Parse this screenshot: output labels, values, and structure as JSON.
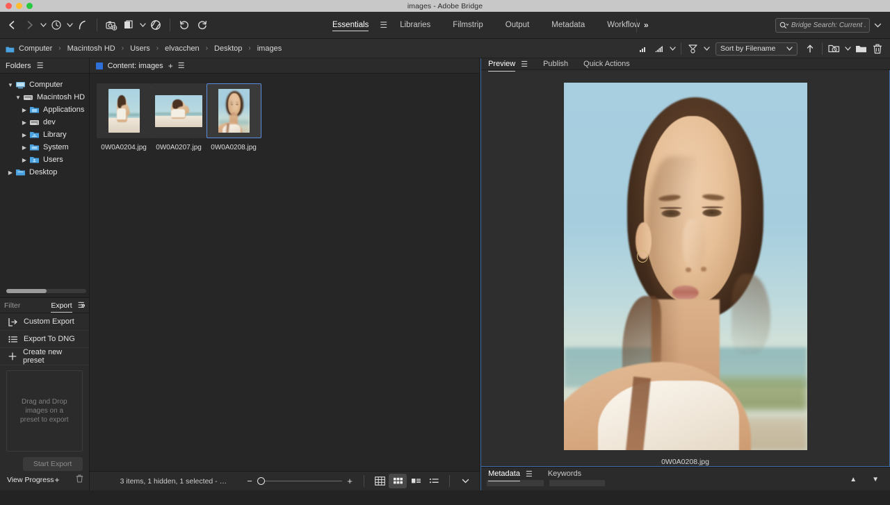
{
  "window": {
    "title": "images - Adobe Bridge"
  },
  "toolbar": {
    "icons": [
      "back-arrow",
      "forward-arrow",
      "chevron-down",
      "recent-folders-clock",
      "chevron-down",
      "boomerang-reveal",
      "get-photos-from-camera",
      "refine-stack",
      "chevron-down",
      "open-in-camera-raw",
      "rotate-counter-clockwise",
      "rotate-clockwise"
    ],
    "workspaces": [
      {
        "label": "Essentials",
        "active": true
      },
      {
        "label": "Libraries",
        "active": false
      },
      {
        "label": "Filmstrip",
        "active": false
      },
      {
        "label": "Output",
        "active": false
      },
      {
        "label": "Metadata",
        "active": false
      },
      {
        "label": "Workflow",
        "active": false
      }
    ],
    "more_label": "»",
    "search": {
      "value": "Bridge Search: Current .",
      "icon": "search-icon"
    }
  },
  "pathbar": {
    "crumbs": [
      "Computer",
      "Macintosh HD",
      "Users",
      "elvacchen",
      "Desktop",
      "images"
    ],
    "separator": "›",
    "sort": {
      "label": "Sort by Filename"
    },
    "icons": [
      "filter-rating-low",
      "filter-rating-high",
      "filter-items-funnel",
      "sort-ascending-arrow",
      "new-folder-recent",
      "new-folder",
      "delete-trash"
    ]
  },
  "folders_panel": {
    "title": "Folders",
    "menu_icon": "panel-menu-icon",
    "tree": [
      {
        "label": "Computer",
        "depth": 0,
        "expanded": true,
        "icon": "computer-icon"
      },
      {
        "label": "Macintosh HD",
        "depth": 1,
        "expanded": true,
        "icon": "hard-drive-icon"
      },
      {
        "label": "Applications",
        "depth": 2,
        "expanded": false,
        "icon": "folder-applications-icon"
      },
      {
        "label": "dev",
        "depth": 2,
        "expanded": false,
        "icon": "folder-dev-icon"
      },
      {
        "label": "Library",
        "depth": 2,
        "expanded": false,
        "icon": "folder-library-icon"
      },
      {
        "label": "System",
        "depth": 2,
        "expanded": false,
        "icon": "folder-system-icon"
      },
      {
        "label": "Users",
        "depth": 2,
        "expanded": false,
        "icon": "folder-users-icon"
      },
      {
        "label": "Desktop",
        "depth": 0,
        "expanded": false,
        "icon": "folder-desktop-icon"
      }
    ]
  },
  "filter_panel": {
    "filter_tab": "Filter",
    "export_tab": "Export",
    "menu_icon": "panel-menu-icon",
    "expand_icon": "»",
    "items": [
      {
        "label": "Custom Export",
        "icon": "custom-export-icon"
      },
      {
        "label": "Export To DNG",
        "icon": "export-dng-icon"
      },
      {
        "label": "Create new preset",
        "icon": "plus-icon"
      }
    ],
    "drop_hint": "Drag and Drop images on a preset to export",
    "start_export": "Start Export",
    "view_progress": "View Progress",
    "trash_icon": "delete-trash"
  },
  "content_panel": {
    "title": "Content: images",
    "plus_icon": "plus-icon",
    "menu_icon": "panel-menu-icon",
    "thumbnails": [
      {
        "name": "0W0A0204.jpg",
        "selected": false,
        "orientation": "portrait"
      },
      {
        "name": "0W0A0207.jpg",
        "selected": false,
        "orientation": "landscape"
      },
      {
        "name": "0W0A0208.jpg",
        "selected": true,
        "orientation": "portrait"
      }
    ]
  },
  "statusbar": {
    "text": "3 items, 1 hidden, 1 selected - …",
    "zoom_out": "−",
    "zoom_in": "+",
    "views": [
      {
        "name": "grid-view-icon",
        "active": false
      },
      {
        "name": "thumbnail-view-icon",
        "active": true
      },
      {
        "name": "details-view-icon",
        "active": false
      },
      {
        "name": "list-view-icon",
        "active": false
      }
    ],
    "more_icon": "chevron-down-icon"
  },
  "preview_panel": {
    "tabs": [
      {
        "label": "Preview",
        "active": true
      },
      {
        "label": "Publish",
        "active": false
      },
      {
        "label": "Quick Actions",
        "active": false
      }
    ],
    "menu_icon": "panel-menu-icon",
    "caption": "0W0A0208.jpg"
  },
  "metadata_panel": {
    "tabs": [
      {
        "label": "Metadata",
        "active": true
      },
      {
        "label": "Keywords",
        "active": false
      }
    ],
    "menu_icon": "panel-menu-icon",
    "up_icon": "chevron-up-icon",
    "down_icon": "chevron-down-icon"
  },
  "colors": {
    "accent_blue": "#2f6fd8",
    "selection_border": "#5a8ee0",
    "panel_bg": "#2b2b2b",
    "content_bg": "#262626",
    "titlebar_bg": "#c8c8c8"
  }
}
